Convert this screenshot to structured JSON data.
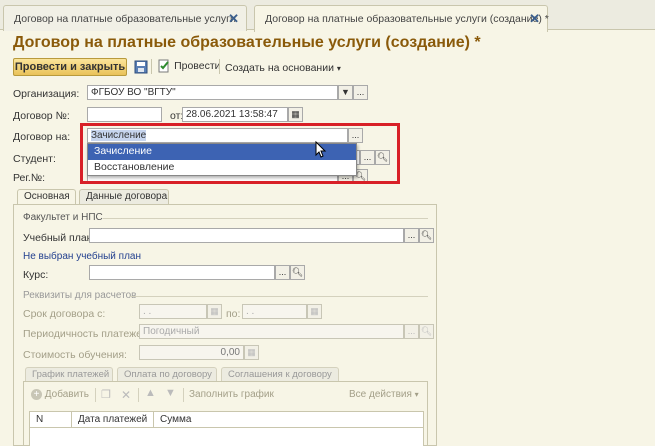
{
  "tabs": [
    {
      "label": "Договор на платные образовательные услуги",
      "active": false
    },
    {
      "label": "Договор на платные образовательные услуги (создание) *",
      "active": true
    }
  ],
  "page_title": "Договор на платные образовательные услуги (создание) *",
  "toolbar": {
    "post_close_label": "Провести и закрыть",
    "post_label": "Провести",
    "create_based_label": "Создать на основании"
  },
  "form": {
    "organization_label": "Организация:",
    "organization_value": "ФГБОУ ВО \"ВГТУ\"",
    "contract_no_label": "Договор №:",
    "contract_no_value": "",
    "date_label": "от:",
    "date_value": "28.06.2021 13:58:47",
    "contract_for_label": "Договор на:",
    "contract_for_value": "Зачисление",
    "student_label": "Студент:",
    "reg_no_label": "Рег.№:"
  },
  "dropdown": {
    "options": [
      {
        "label": "Зачисление",
        "selected": true
      },
      {
        "label": "Восстановление",
        "selected": false
      }
    ]
  },
  "panel_tabs": [
    "Основная",
    "Данные договора"
  ],
  "main_tab": {
    "faculty_section": "Факультет и НПС",
    "study_plan_label": "Учебный план:",
    "study_plan_value": "",
    "no_plan_text": "Не выбран учебный план",
    "course_label": "Курс:",
    "course_value": "",
    "payment_section": "Реквизиты для расчетов",
    "term_from_label": "Срок договора с:",
    "term_from_value": " .  .",
    "term_to_label": "по:",
    "term_to_value": " .  .",
    "periodicity_label": "Периодичность платежей:",
    "periodicity_value": "Погодичный",
    "cost_label": "Стоимость обучения:",
    "cost_value": "0,00"
  },
  "inner_tabs": [
    "График платежей",
    "Оплата по договору",
    "Соглашения к договору"
  ],
  "grid_toolbar": {
    "add_label": "Добавить",
    "fill_schedule_label": "Заполнить график",
    "all_actions_label": "Все действия"
  },
  "grid_columns": [
    "N",
    "Дата платежей",
    "Сумма"
  ],
  "colors": {
    "title": "#8a5a0a",
    "highlight": "#d82027",
    "selection": "#3d63b3",
    "background": "#f7f5e6"
  }
}
